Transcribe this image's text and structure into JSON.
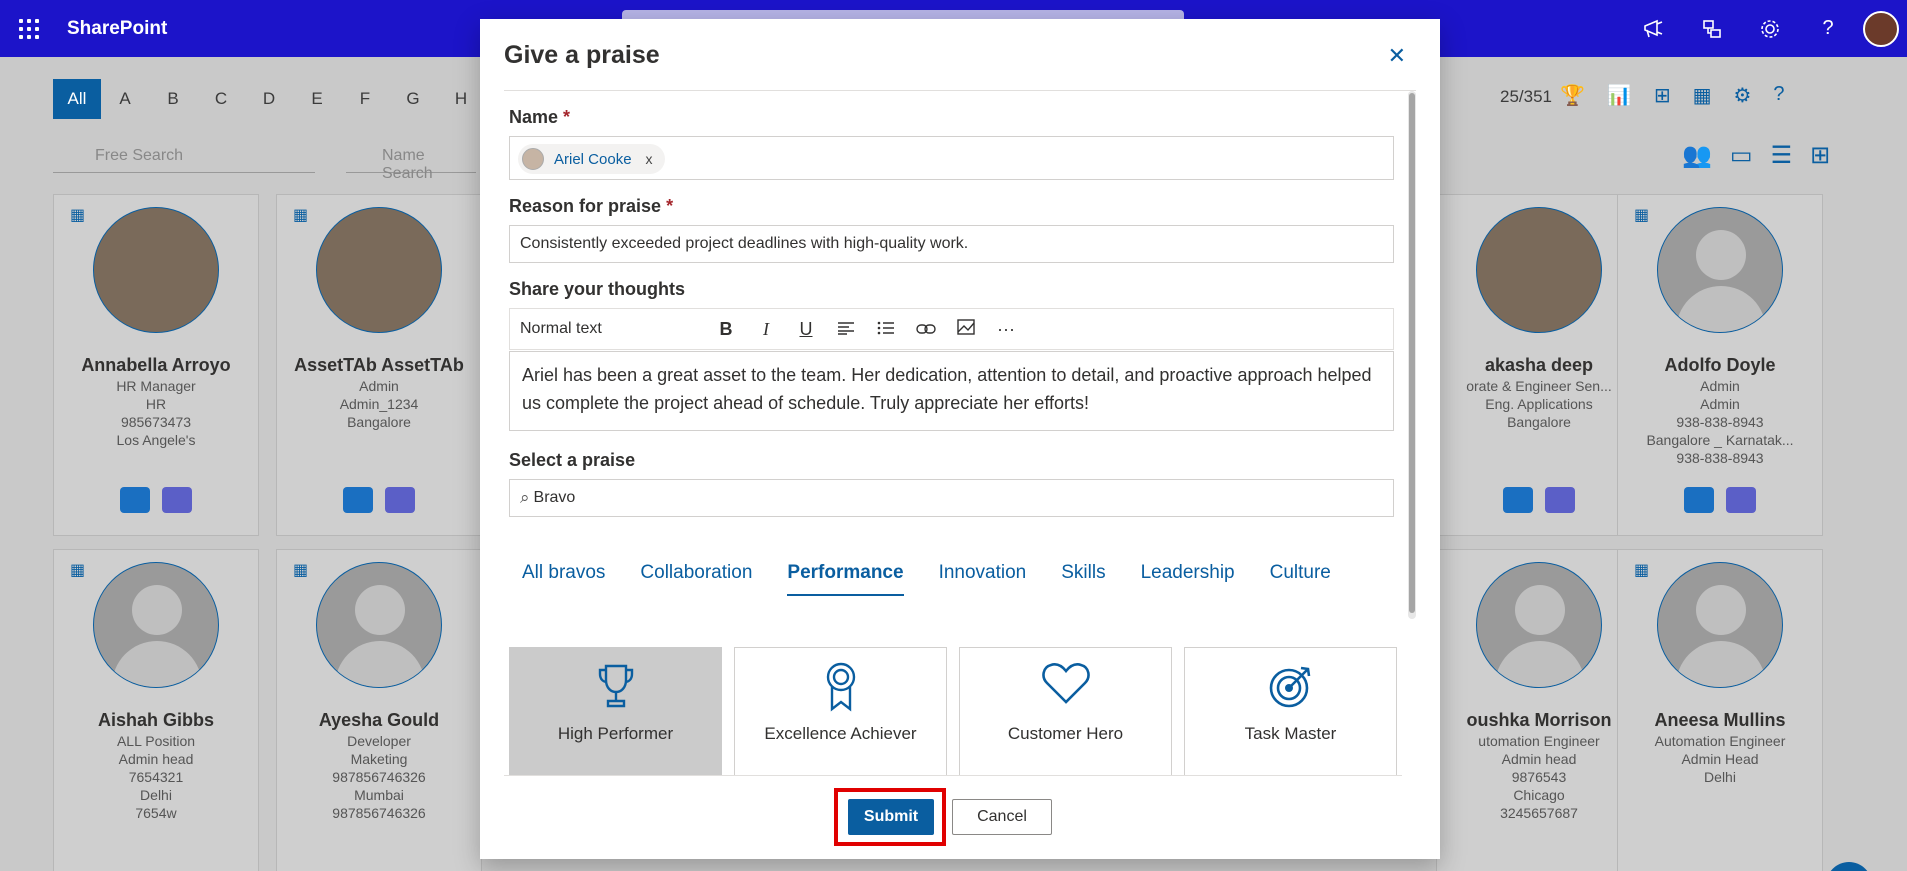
{
  "suitebar": {
    "brand": "SharePoint",
    "icons": [
      "megaphone-icon",
      "share-icon",
      "gear-icon",
      "help-icon"
    ],
    "help_glyph": "?"
  },
  "directory": {
    "letters": [
      "All",
      "A",
      "B",
      "C",
      "D",
      "E",
      "F",
      "G",
      "H"
    ],
    "count": "25/351",
    "free_search_placeholder": "Free Search",
    "name_search_placeholder": "Name Search",
    "cards": [
      {
        "name": "Annabella Arroyo",
        "lines": [
          "HR Manager",
          "HR",
          "985673473",
          "Los Angele's"
        ]
      },
      {
        "name": "AssetTAb AssetTAb",
        "lines": [
          "Admin",
          "Admin_1234",
          "Bangalore"
        ]
      },
      {
        "name": "akasha deep",
        "lines": [
          "orate & Engineer Sen...",
          "Eng. Applications",
          "Bangalore"
        ]
      },
      {
        "name": "Adolfo Doyle",
        "lines": [
          "Admin",
          "Admin",
          "938-838-8943",
          "Bangalore _ Karnatak...",
          "938-838-8943"
        ]
      },
      {
        "name": "Aishah Gibbs",
        "lines": [
          "ALL Position",
          "Admin head",
          "7654321",
          "Delhi",
          "7654w"
        ]
      },
      {
        "name": "Ayesha Gould",
        "lines": [
          "Developer",
          "Maketing",
          "987856746326",
          "Mumbai",
          "987856746326"
        ]
      },
      {
        "name": "oushka Morrison",
        "lines": [
          "utomation Engineer",
          "Admin head",
          "9876543",
          "Chicago",
          "3245657687"
        ]
      },
      {
        "name": "Aneesa Mullins",
        "lines": [
          "Automation Engineer",
          "Admin Head",
          "Delhi"
        ]
      }
    ]
  },
  "modal": {
    "title": "Give a praise",
    "close_glyph": "✕",
    "name_label": "Name",
    "required_mark": "*",
    "selected_person": "Ariel Cooke",
    "remove_glyph": "x",
    "reason_label": "Reason for praise",
    "reason_value": "Consistently exceeded project deadlines with high-quality work.",
    "thoughts_label": "Share your thoughts",
    "format_select": "Normal text",
    "toolbar": {
      "bold": "B",
      "italic": "I",
      "underline": "U",
      "more": "···"
    },
    "thoughts_text": "Ariel has been a great asset to the team. Her dedication, attention to detail, and proactive approach helped us complete the project ahead of schedule. Truly appreciate her efforts!",
    "select_praise_label": "Select a praise",
    "praise_search_value": "Bravo",
    "tabs": [
      "All bravos",
      "Collaboration",
      "Performance",
      "Innovation",
      "Skills",
      "Leadership",
      "Culture"
    ],
    "active_tab": "Performance",
    "badges": [
      "High Performer",
      "Excellence Achiever",
      "Customer Hero",
      "Task Master"
    ],
    "selected_badge": "High Performer",
    "submit_label": "Submit",
    "cancel_label": "Cancel"
  },
  "colors": {
    "suitebar": "#1c14c9",
    "accent": "#0a5ea0",
    "highlight": "#e00000"
  }
}
